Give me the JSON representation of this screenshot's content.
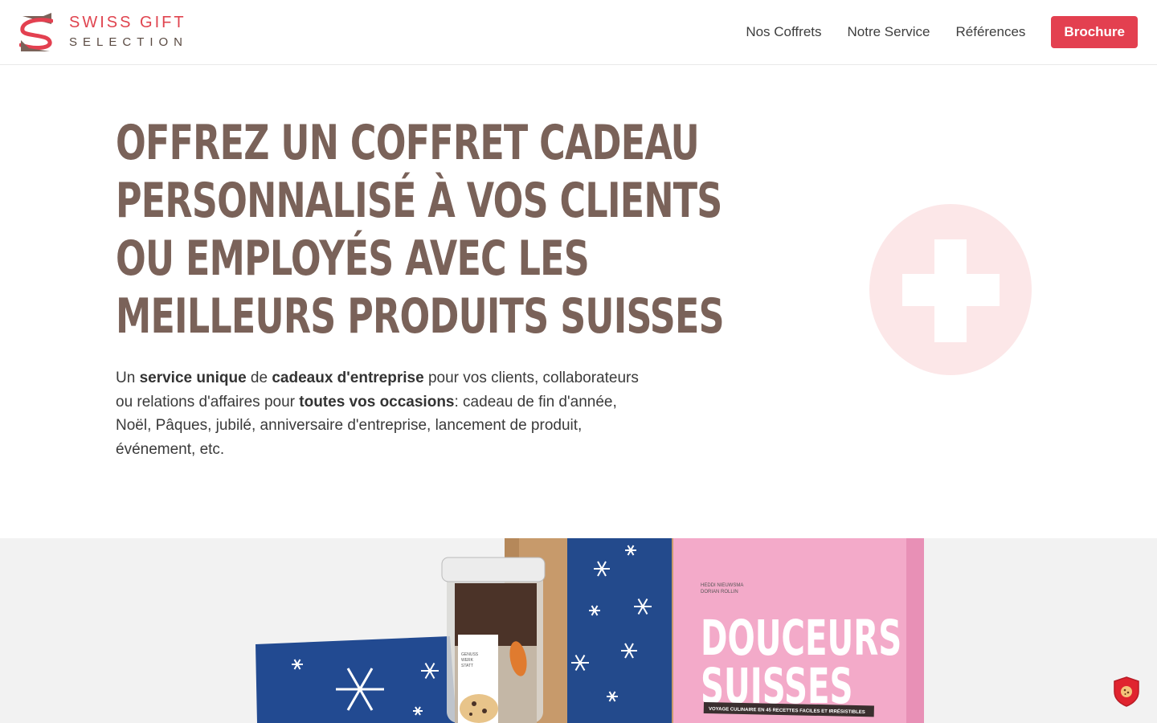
{
  "brand": {
    "line1": "SWISS GIFT",
    "line2": "SELECTION",
    "mark_icon": "swiss-gift-s-logo",
    "accent_color": "#e34050",
    "brown_color": "#7a6259"
  },
  "nav": {
    "items": [
      {
        "label": "Nos Coffrets"
      },
      {
        "label": "Notre Service"
      },
      {
        "label": "Références"
      }
    ],
    "cta_label": "Brochure"
  },
  "hero": {
    "title_lines": [
      "Offrez un coffret cadeau",
      "personnalisé à vos clients",
      "ou employés avec les",
      "meilleurs produits suisses"
    ],
    "intro_parts": [
      {
        "text": "Un ",
        "bold": false
      },
      {
        "text": "service unique",
        "bold": true
      },
      {
        "text": " de ",
        "bold": false
      },
      {
        "text": "cadeaux d'entreprise",
        "bold": true
      },
      {
        "text": " pour vos clients, collaborateurs ou relations d'affaires pour ",
        "bold": false
      },
      {
        "text": "toutes vos occasions",
        "bold": true
      },
      {
        "text": ": cadeau de fin d'année, Noël, Pâques, jubilé, anniversaire d'entreprise, lancement de produit, événement, etc.",
        "bold": false
      }
    ],
    "badge_icon": "swiss-cross-icon"
  },
  "product_image": {
    "book_authors_line1": "HEDDI NIEUWSMA",
    "book_authors_line2": "DORIAN ROLLIN",
    "book_title_line1": "DOUCEURS",
    "book_title_line2": "SUISSES",
    "book_subtitle": "VOYAGE CULINAIRE EN 45 RECETTES FACILES ET IRRÉSISTIBLES",
    "jar_label_line1": "GENUSS",
    "jar_label_line2": "WERK",
    "jar_label_line3": "STATT"
  },
  "cookie_icon": "cookie-shield-icon"
}
